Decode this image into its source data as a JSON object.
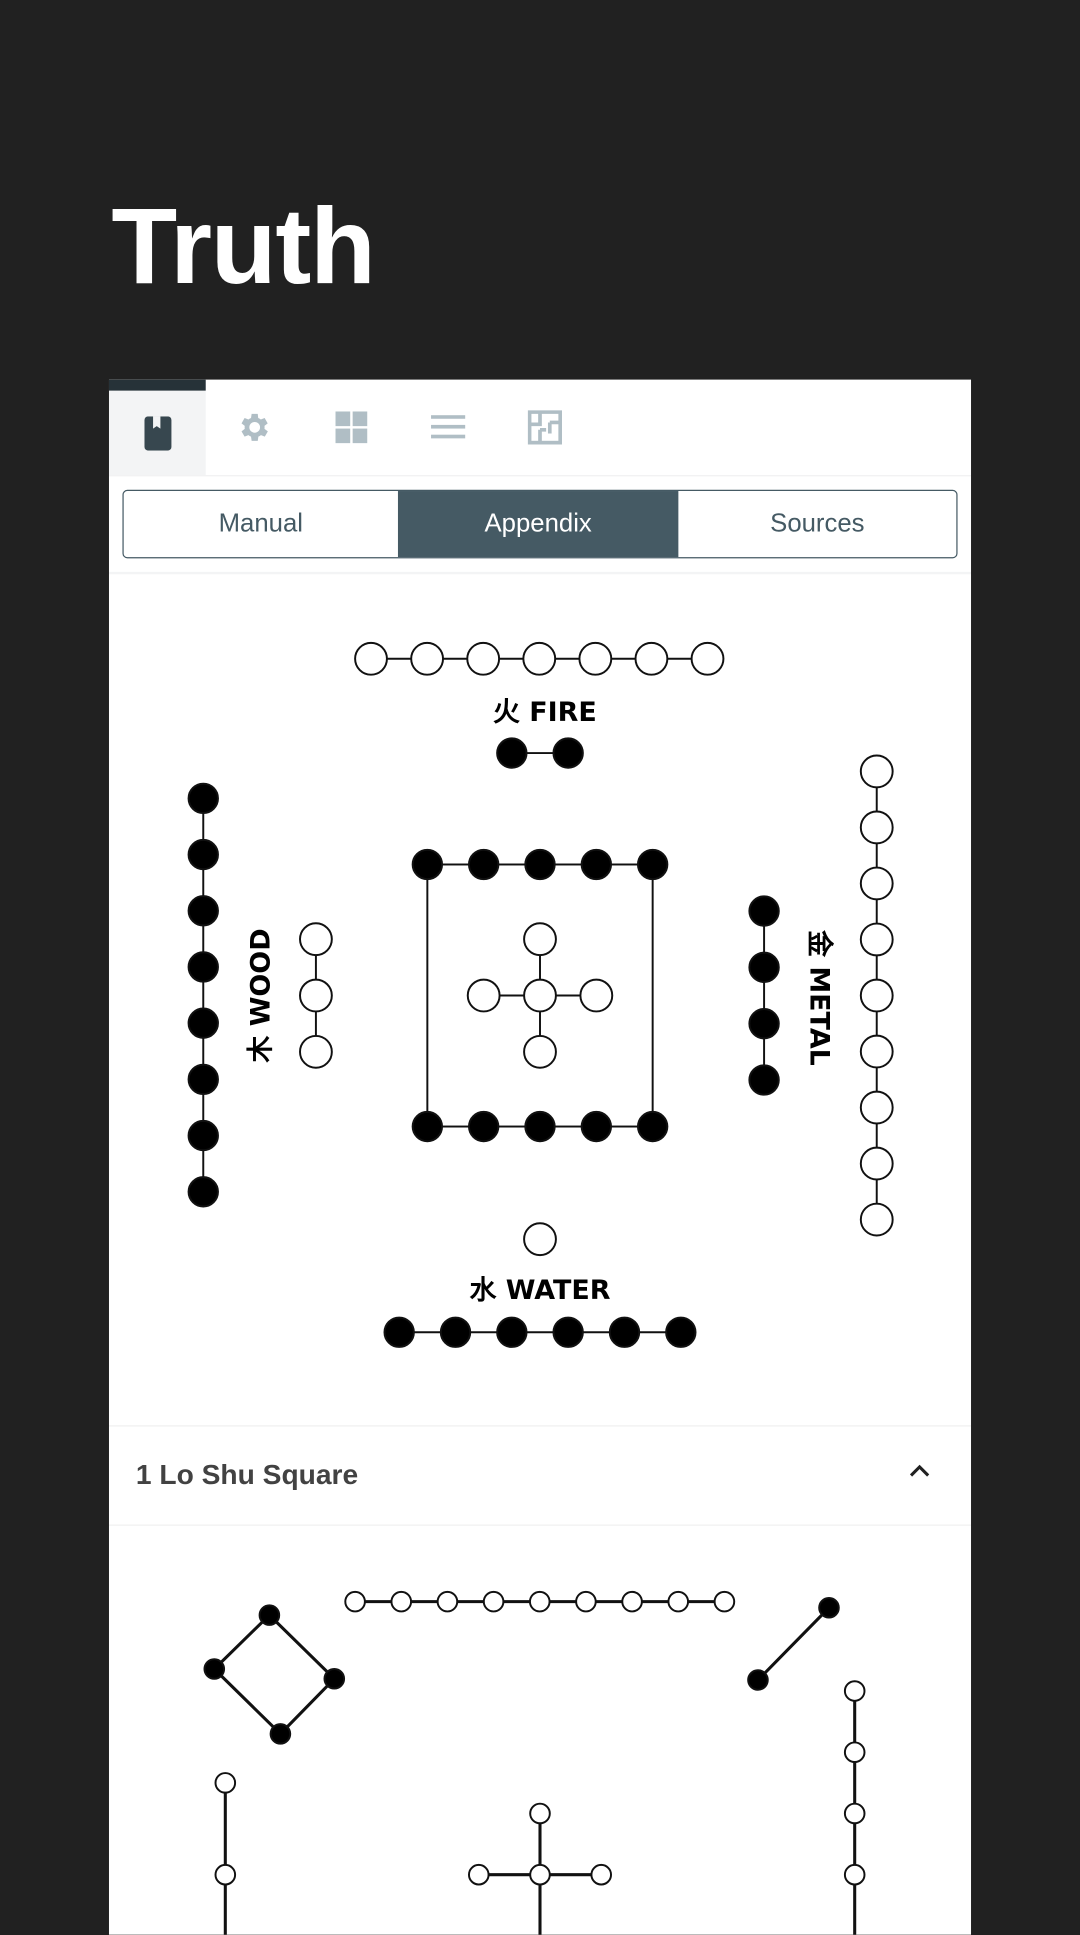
{
  "header": {
    "title": "Truth"
  },
  "tabs": [
    {
      "icon": "book-icon",
      "active": true
    },
    {
      "icon": "gear-icon",
      "active": false
    },
    {
      "icon": "grid-icon",
      "active": false
    },
    {
      "icon": "menu-icon",
      "active": false
    },
    {
      "icon": "layout-icon",
      "active": false
    }
  ],
  "segments": {
    "items": [
      "Manual",
      "Appendix",
      "Sources"
    ],
    "selected": "Appendix"
  },
  "hetu": {
    "fire": "火 FIRE",
    "wood": "木 WOOD",
    "metal": "金 METAL",
    "water": "水 WATER"
  },
  "accordion": {
    "title": "1 Lo Shu Square",
    "expanded": true
  },
  "colors": {
    "background": "#212121",
    "accent": "#455a64",
    "icon_inactive": "#b0bec5",
    "icon_active": "#37474f"
  }
}
